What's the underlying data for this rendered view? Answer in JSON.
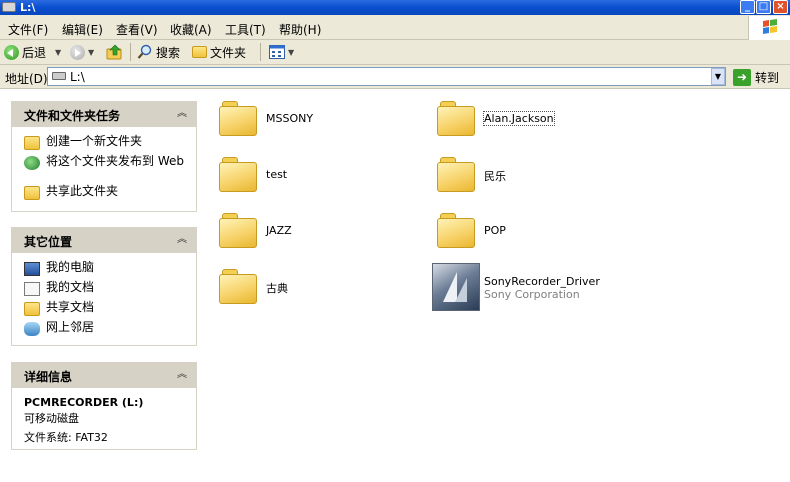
{
  "window": {
    "title": "L:\\"
  },
  "menu": {
    "items": [
      "文件(F)",
      "编辑(E)",
      "查看(V)",
      "收藏(A)",
      "工具(T)",
      "帮助(H)"
    ]
  },
  "toolbar": {
    "back": "后退",
    "search": "搜索",
    "folders": "文件夹"
  },
  "address": {
    "label": "地址(D)",
    "value": "L:\\",
    "go": "转到"
  },
  "panes": {
    "tasks": {
      "title": "文件和文件夹任务",
      "items": [
        "创建一个新文件夹",
        "将这个文件夹发布到 Web",
        "共享此文件夹"
      ]
    },
    "places": {
      "title": "其它位置",
      "items": [
        "我的电脑",
        "我的文档",
        "共享文档",
        "网上邻居"
      ]
    },
    "details": {
      "title": "详细信息",
      "name": "PCMRECORDER (L:)",
      "type": "可移动磁盘",
      "fs": "文件系统: FAT32"
    }
  },
  "files": [
    {
      "name": "MSSONY"
    },
    {
      "name": "Alan.Jackson"
    },
    {
      "name": "test"
    },
    {
      "name": "民乐"
    },
    {
      "name": "JAZZ"
    },
    {
      "name": "POP"
    },
    {
      "name": "古典"
    },
    {
      "name": "SonyRecorder_Driver",
      "sub": "Sony Corporation"
    }
  ]
}
